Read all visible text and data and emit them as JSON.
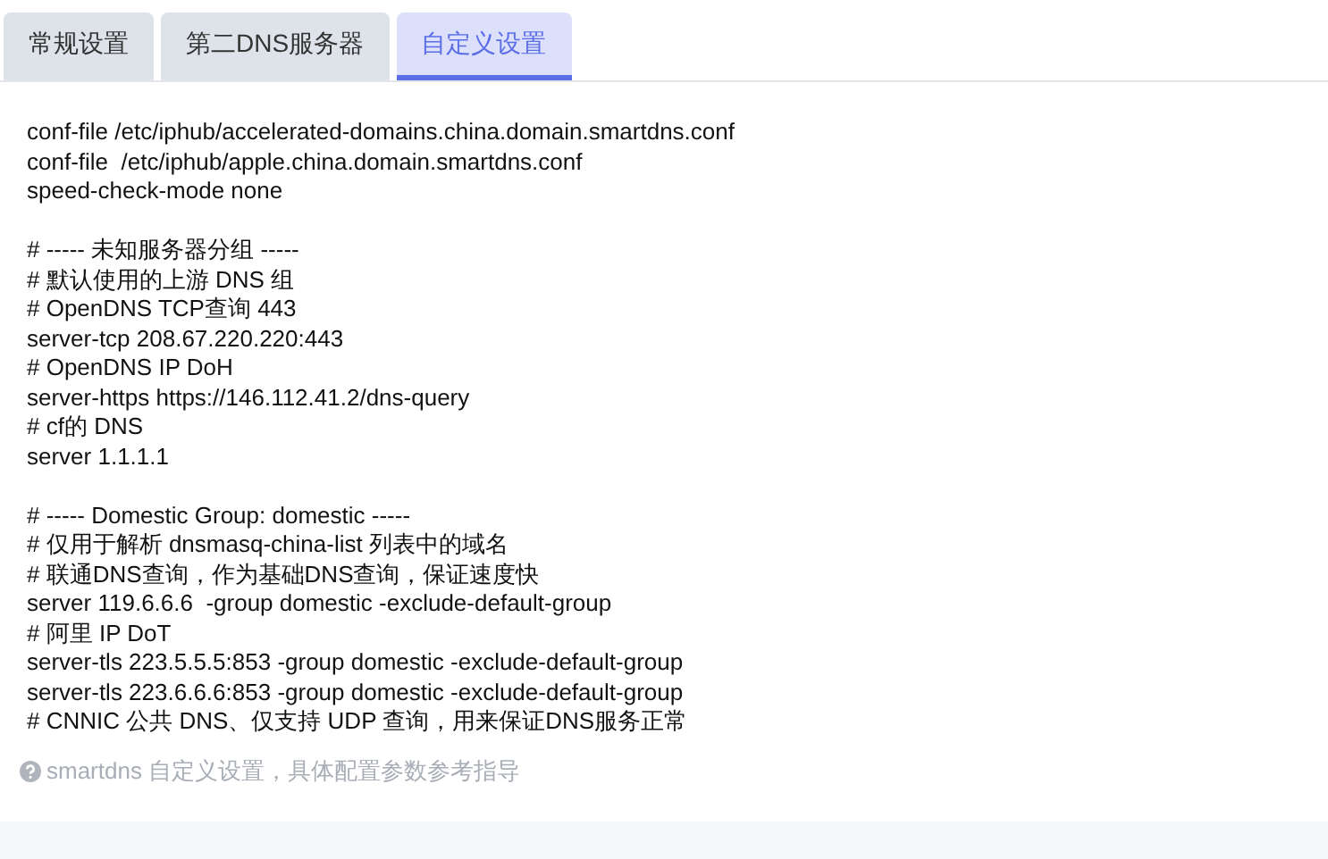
{
  "tabs": [
    {
      "label": "常规设置",
      "selected": false
    },
    {
      "label": "第二DNS服务器",
      "selected": false
    },
    {
      "label": "自定义设置",
      "selected": true
    }
  ],
  "editor": {
    "blocks": [
      [
        "conf-file /etc/iphub/accelerated-domains.china.domain.smartdns.conf",
        "conf-file  /etc/iphub/apple.china.domain.smartdns.conf",
        "speed-check-mode none"
      ],
      [
        "# ----- 未知服务器分组 -----",
        "# 默认使用的上游 DNS 组",
        "# OpenDNS TCP查询 443",
        "server-tcp 208.67.220.220:443",
        "# OpenDNS IP DoH",
        "server-https https://146.112.41.2/dns-query",
        "# cf的 DNS",
        "server 1.1.1.1"
      ],
      [
        "# ----- Domestic Group: domestic -----",
        "# 仅用于解析 dnsmasq-china-list 列表中的域名",
        "# 联通DNS查询，作为基础DNS查询，保证速度快",
        "server 119.6.6.6  -group domestic -exclude-default-group",
        "# 阿里 IP DoT",
        "server-tls 223.5.5.5:853 -group domestic -exclude-default-group",
        "server-tls 223.6.6.6:853 -group domestic -exclude-default-group",
        "# CNNIC 公共 DNS、仅支持 UDP 查询，用来保证DNS服务正常"
      ]
    ]
  },
  "hint": "smartdns 自定义设置，具体配置参数参考指导"
}
